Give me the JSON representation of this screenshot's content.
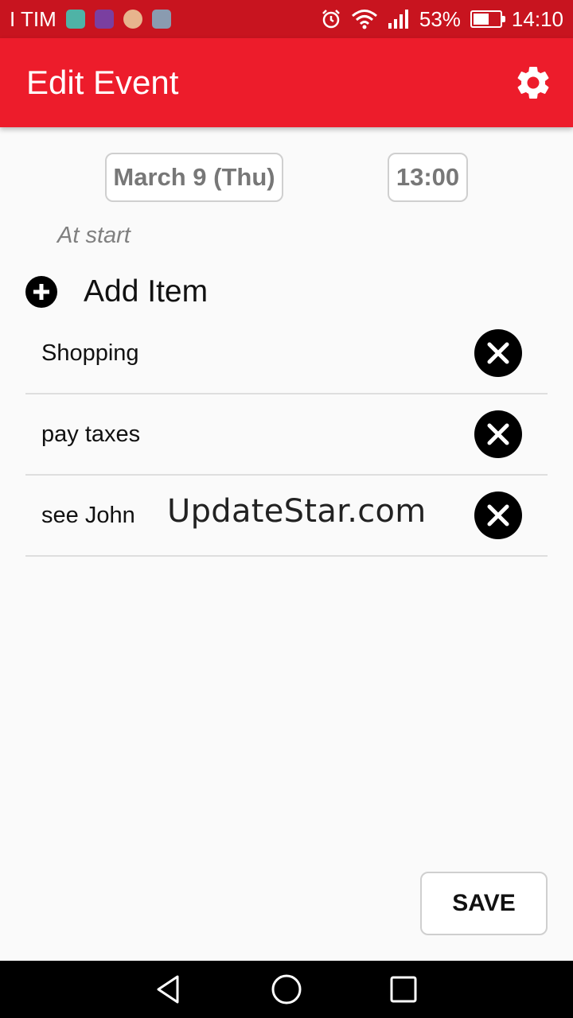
{
  "status_bar": {
    "carrier": "I TIM",
    "battery_percent": "53%",
    "battery_level": 0.53,
    "time": "14:10",
    "icons": [
      "app-notification-icon",
      "app-notification-icon",
      "avatar-notification-icon",
      "gallery-notification-icon",
      "alarm-icon",
      "wifi-icon",
      "signal-icon",
      "battery-icon"
    ]
  },
  "app_bar": {
    "title": "Edit Event",
    "settings_icon": "gear-icon"
  },
  "event": {
    "date": "March 9 (Thu)",
    "time": "13:00",
    "reminder_label": "At start"
  },
  "add_item": {
    "label": "Add Item",
    "icon": "plus-circle-icon"
  },
  "items": [
    {
      "label": "Shopping"
    },
    {
      "label": "pay taxes"
    },
    {
      "label": "see John"
    }
  ],
  "watermark": "UpdateStar.com",
  "save_label": "SAVE",
  "colors": {
    "status_bar": "#c8141f",
    "app_bar": "#ed1c2b",
    "background": "#fafafa"
  }
}
